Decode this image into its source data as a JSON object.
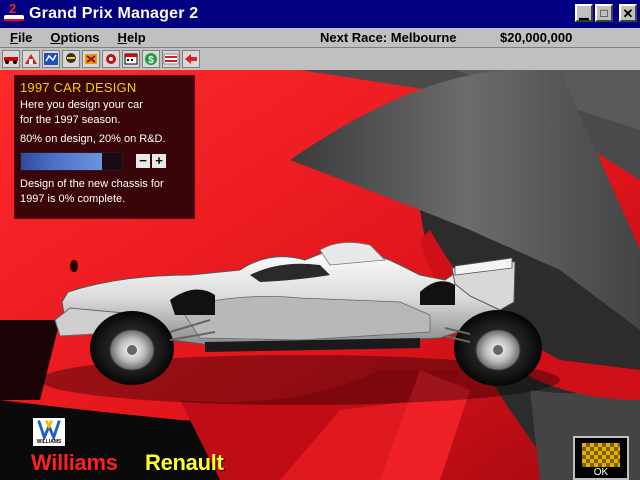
{
  "window": {
    "title": "Grand Prix Manager 2"
  },
  "menu": {
    "items": [
      {
        "label": "File"
      },
      {
        "label": "Options"
      },
      {
        "label": "Help"
      }
    ],
    "next_race": "Next Race: Melbourne",
    "money": "$20,000,000"
  },
  "toolbar": {
    "icons": [
      "car-icon",
      "team-icon",
      "map-icon",
      "driver-icon",
      "sponsor-icon",
      "engine-icon",
      "calendar-icon",
      "money-icon",
      "stats-icon",
      "back-arrow-icon"
    ]
  },
  "panel": {
    "title": "1997 CAR DESIGN",
    "line1": "Here you design your car",
    "line2": "for the 1997 season.",
    "split": "80% on design, 20% on R&D.",
    "split_design_fraction": 0.8,
    "minus": "−",
    "plus": "+",
    "status1": "Design of the new chassis for",
    "status2": "1997 is 0% complete."
  },
  "team": {
    "name1": "Williams",
    "name2": "Renault",
    "logo_text": "WILLIAMS"
  },
  "ok": {
    "label": "OK"
  },
  "colors": {
    "titlebar": "#000080",
    "scene_red": "#e0141c",
    "panel_bg": "#3a0508",
    "panel_title": "#f4d000",
    "williams": "#ff2020",
    "renault": "#ffff30"
  }
}
